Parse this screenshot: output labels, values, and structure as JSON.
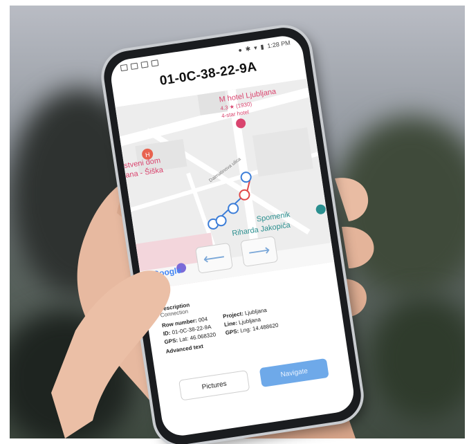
{
  "status_bar": {
    "time": "1:28 PM"
  },
  "title": "01-0C-38-22-9A",
  "map": {
    "hotel_name": "M hotel Ljubljana",
    "hotel_rating": "4.3 ★ (1930)",
    "hotel_stars": "4-star hotel",
    "place_1_line1": "stveni dom",
    "place_1_line2": "ana - Šiška",
    "street": "Dalmatinova ulica",
    "monument_line1": "Spomenik",
    "monument_line2": "Riharda Jakopiča",
    "google_logo": "Google",
    "arrow_left": "⟵",
    "arrow_right": "⟶"
  },
  "details": {
    "description_label": "Description",
    "description_value": "Connection",
    "row_number_label": "Row number:",
    "row_number_value": "004",
    "id_label": "ID:",
    "id_value": "01-0C-38-22-9A",
    "gps_lat_label": "GPS:",
    "gps_lat_value": "Lat: 46.068320",
    "project_label": "Project:",
    "project_value": "Ljubljana",
    "line_label": "Line:",
    "line_value": "Ljubljana",
    "gps_lng_label": "GPS:",
    "gps_lng_value": "Lng: 14.488620",
    "advanced_text": "Advanced text"
  },
  "buttons": {
    "pictures": "Pictures",
    "navigate": "Navigate"
  },
  "colors": {
    "accent": "#6ea9e9",
    "marker_blue": "#3b7dd8",
    "marker_red": "#e04848",
    "map_pink": "#d9446e",
    "map_teal": "#2a8f8f"
  }
}
